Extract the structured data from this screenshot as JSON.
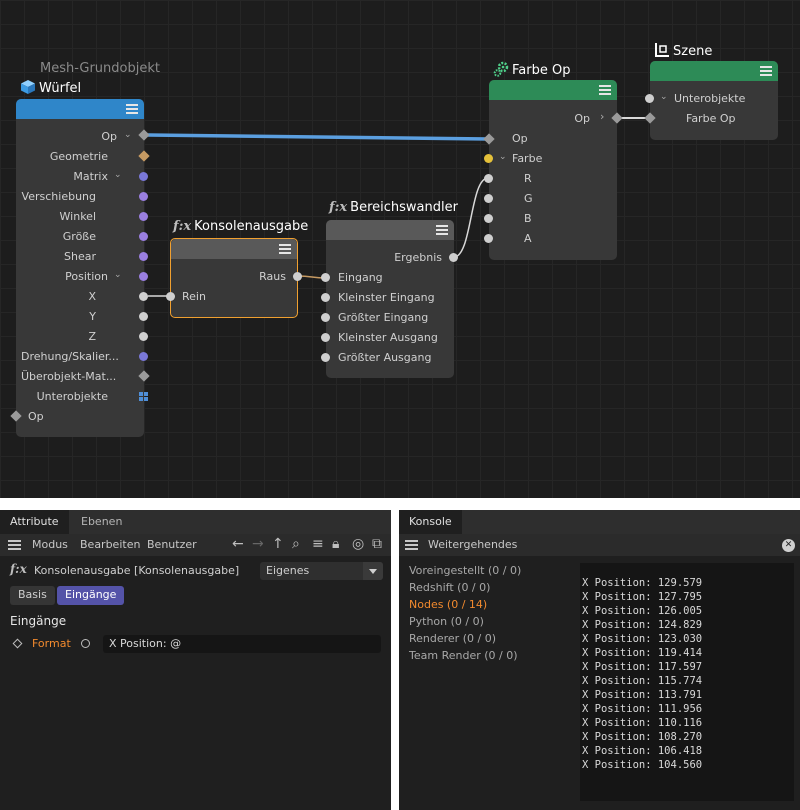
{
  "colors": {
    "mesh_header": "#2f86c9",
    "green_header": "#2d8b57",
    "active_tab": "#5453a8",
    "active_category": "#f28a2e",
    "wire_op": "#5b9fe0",
    "selected_outline": "#f0a030"
  },
  "nodes": {
    "wuerfel": {
      "subtitle": "Mesh-Grundobjekt",
      "title": "Würfel",
      "icon": "cube-icon",
      "ports": {
        "op": "Op",
        "geometrie": "Geometrie",
        "matrix": "Matrix",
        "verschiebung": "Verschiebung",
        "winkel": "Winkel",
        "groesse": "Größe",
        "shear": "Shear",
        "position": "Position",
        "x": "X",
        "y": "Y",
        "z": "Z",
        "drehung": "Drehung/Skalier...",
        "ueberobjekt": "Überobjekt-Mat...",
        "unterobjekte": "Unterobjekte",
        "op_in": "Op"
      }
    },
    "konsolenausgabe": {
      "title": "Konsolenausgabe",
      "glyph": "f:x",
      "ports": {
        "raus": "Raus",
        "rein": "Rein"
      }
    },
    "bereichswandler": {
      "title": "Bereichswandler",
      "glyph": "f:x",
      "ports": {
        "ergebnis": "Ergebnis",
        "eingang": "Eingang",
        "kleinster_eingang": "Kleinster Eingang",
        "groesster_eingang": "Größter Eingang",
        "kleinster_ausgang": "Kleinster Ausgang",
        "groesster_ausgang": "Größter Ausgang"
      }
    },
    "farbe_op": {
      "title": "Farbe Op",
      "icon": "gears-icon",
      "ports": {
        "op": "Op",
        "farbe": "Farbe",
        "r": "R",
        "g": "G",
        "b": "B",
        "a": "A"
      }
    },
    "szene": {
      "title": "Szene",
      "icon": "scene-icon",
      "ports": {
        "op": "Op",
        "unterobjekte": "Unterobjekte",
        "farbe_op": "Farbe Op"
      }
    }
  },
  "attribute_panel": {
    "tabs": [
      "Attribute",
      "Ebenen"
    ],
    "menu": [
      "Modus",
      "Bearbeiten",
      "Benutzer"
    ],
    "object_label": "Konsolenausgabe [Konsolenausgabe]",
    "object_glyph": "f:x",
    "dropdown_value": "Eigenes",
    "buttons": [
      "Basis",
      "Eingänge"
    ],
    "section_title": "Eingänge",
    "format_label": "Format",
    "format_value": "X Position: @"
  },
  "console_panel": {
    "tab": "Konsole",
    "toolbar_label": "Weitergehendes",
    "categories": [
      "Voreingestellt (0 / 0)",
      "Redshift (0 / 0)",
      "Nodes (0 / 14)",
      "Python (0 / 0)",
      "Renderer (0 / 0)",
      "Team Render  (0 / 0)"
    ],
    "output_lines": [
      "X Position: 129.579",
      "X Position: 127.795",
      "X Position: 126.005",
      "X Position: 124.829",
      "X Position: 123.030",
      "X Position: 119.414",
      "X Position: 117.597",
      "X Position: 115.774",
      "X Position: 113.791",
      "X Position: 111.956",
      "X Position: 110.116",
      "X Position: 108.270",
      "X Position: 106.418",
      "X Position: 104.560"
    ]
  }
}
